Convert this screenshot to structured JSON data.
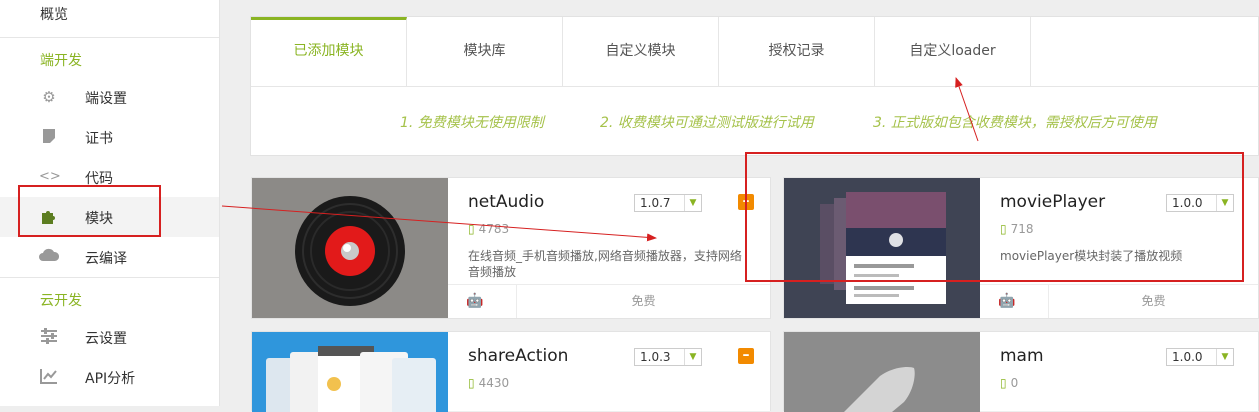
{
  "sidebar": {
    "overview": "概览",
    "group_client": "端开发",
    "items_client": [
      {
        "label": "端设置",
        "icon": "gear-icon"
      },
      {
        "label": "证书",
        "icon": "certificate-icon"
      },
      {
        "label": "代码",
        "icon": "code-icon"
      },
      {
        "label": "模块",
        "icon": "puzzle-icon"
      },
      {
        "label": "云编译",
        "icon": "cloud-icon"
      }
    ],
    "group_cloud": "云开发",
    "items_cloud": [
      {
        "label": "云设置",
        "icon": "sliders-icon"
      },
      {
        "label": "API分析",
        "icon": "chart-icon"
      }
    ]
  },
  "tabs": [
    "已添加模块",
    "模块库",
    "自定义模块",
    "授权记录",
    "自定义loader"
  ],
  "notices": [
    "1. 免费模块无使用限制",
    "2. 收费模块可通过测试版进行试用",
    "3. 正式版如包含收费模块，需授权后方可使用"
  ],
  "modules": [
    {
      "name": "netAudio",
      "version": "1.0.7",
      "downloads": "4783",
      "desc": "在线音频_手机音频播放,网络音频播放器，支持网络音频播放",
      "price": "免费"
    },
    {
      "name": "moviePlayer",
      "version": "1.0.0",
      "downloads": "718",
      "desc": "moviePlayer模块封装了播放视频",
      "price": "免费"
    },
    {
      "name": "shareAction",
      "version": "1.0.3",
      "downloads": "4430",
      "desc": "",
      "price": ""
    },
    {
      "name": "mam",
      "version": "1.0.0",
      "downloads": "0",
      "desc": "",
      "price": ""
    }
  ],
  "colors": {
    "accent": "#8ab423",
    "annotation": "#d62020",
    "remove": "#f28a00"
  }
}
